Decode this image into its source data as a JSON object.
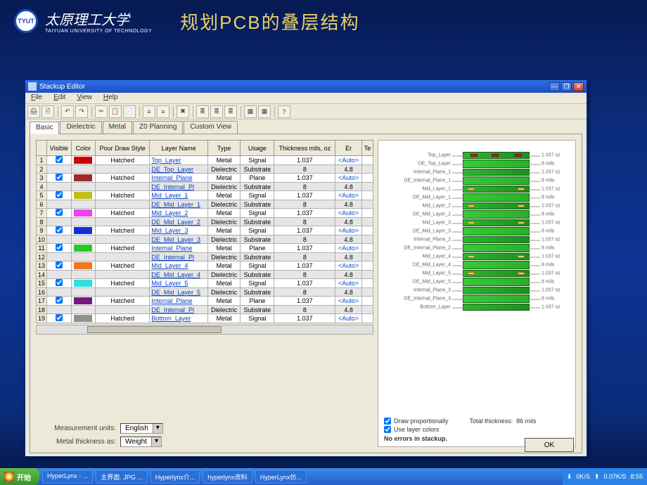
{
  "university": {
    "cn": "太原理工大学",
    "en": "TAIYUAN UNIVERSITY OF TECHNOLOGY"
  },
  "slide_title": "规划PCB的叠层结构",
  "app": {
    "title": "Stackup Editor",
    "menus": [
      "File",
      "Edit",
      "View",
      "Help"
    ],
    "tabs": [
      "Basic",
      "Dielectric",
      "Metal",
      "Z0 Planning",
      "Custom View"
    ],
    "active_tab": 0,
    "columns": [
      "",
      "Visible",
      "Color",
      "Pour Draw Style",
      "Layer Name",
      "Type",
      "Usage",
      "Thickness mils, oz",
      "Er",
      "Te"
    ],
    "rows": [
      {
        "n": "1",
        "vis": true,
        "color": "#d00000",
        "pds": "Hatched",
        "name": "Top_Layer",
        "type": "Metal",
        "usage": "Signal",
        "thk": "1.037",
        "er": "<Auto>"
      },
      {
        "n": "2",
        "vis": false,
        "color": "",
        "pds": "",
        "name": "DE_Top_Layer",
        "type": "Dielectric",
        "usage": "Substrate",
        "thk": "8",
        "er": "4.8",
        "sub": true
      },
      {
        "n": "3",
        "vis": true,
        "color": "#a02a2a",
        "pds": "Hatched",
        "name": "Internal_Plane",
        "type": "Metal",
        "usage": "Plane",
        "thk": "1.037",
        "er": "<Auto>"
      },
      {
        "n": "4",
        "vis": false,
        "color": "",
        "pds": "",
        "name": "DE_Internal_Pl",
        "type": "Dielectric",
        "usage": "Substrate",
        "thk": "8",
        "er": "4.8",
        "sub": true
      },
      {
        "n": "5",
        "vis": true,
        "color": "#c0c018",
        "pds": "Hatched",
        "name": "Mid_Layer_1",
        "type": "Metal",
        "usage": "Signal",
        "thk": "1.037",
        "er": "<Auto>"
      },
      {
        "n": "6",
        "vis": false,
        "color": "",
        "pds": "",
        "name": "DE_Mid_Layer_1",
        "type": "Dielectric",
        "usage": "Substrate",
        "thk": "8",
        "er": "4.8",
        "sub": true
      },
      {
        "n": "7",
        "vis": true,
        "color": "#ee44ee",
        "pds": "Hatched",
        "name": "Mid_Layer_2",
        "type": "Metal",
        "usage": "Signal",
        "thk": "1.037",
        "er": "<Auto>"
      },
      {
        "n": "8",
        "vis": false,
        "color": "",
        "pds": "",
        "name": "DE_Mid_Layer_2",
        "type": "Dielectric",
        "usage": "Substrate",
        "thk": "8",
        "er": "4.8",
        "sub": true
      },
      {
        "n": "9",
        "vis": true,
        "color": "#1030d8",
        "pds": "Hatched",
        "name": "Mid_Layer_3",
        "type": "Metal",
        "usage": "Signal",
        "thk": "1.037",
        "er": "<Auto>"
      },
      {
        "n": "10",
        "vis": false,
        "color": "",
        "pds": "",
        "name": "DE_Mid_Layer_3",
        "type": "Dielectric",
        "usage": "Substrate",
        "thk": "8",
        "er": "4.8",
        "sub": true
      },
      {
        "n": "11",
        "vis": true,
        "color": "#28c828",
        "pds": "Hatched",
        "name": "Internal_Plane",
        "type": "Metal",
        "usage": "Plane",
        "thk": "1.037",
        "er": "<Auto>"
      },
      {
        "n": "12",
        "vis": false,
        "color": "",
        "pds": "",
        "name": "DE_Internal_Pl",
        "type": "Dielectric",
        "usage": "Substrate",
        "thk": "8",
        "er": "4.8",
        "sub": true
      },
      {
        "n": "13",
        "vis": true,
        "color": "#f07820",
        "pds": "Hatched",
        "name": "Mid_Layer_4",
        "type": "Metal",
        "usage": "Signal",
        "thk": "1.037",
        "er": "<Auto>"
      },
      {
        "n": "14",
        "vis": false,
        "color": "",
        "pds": "",
        "name": "DE_Mid_Layer_4",
        "type": "Dielectric",
        "usage": "Substrate",
        "thk": "8",
        "er": "4.8",
        "sub": true
      },
      {
        "n": "15",
        "vis": true,
        "color": "#30e0e0",
        "pds": "Hatched",
        "name": "Mid_Layer_5",
        "type": "Metal",
        "usage": "Signal",
        "thk": "1.037",
        "er": "<Auto>"
      },
      {
        "n": "16",
        "vis": false,
        "color": "",
        "pds": "",
        "name": "DE_Mid_Layer_5",
        "type": "Dielectric",
        "usage": "Substrate",
        "thk": "8",
        "er": "4.8",
        "sub": true
      },
      {
        "n": "17",
        "vis": true,
        "color": "#781878",
        "pds": "Hatched",
        "name": "Internal_Plane",
        "type": "Metal",
        "usage": "Plane",
        "thk": "1.037",
        "er": "<Auto>"
      },
      {
        "n": "18",
        "vis": false,
        "color": "",
        "pds": "",
        "name": "DE_Internal_Pl",
        "type": "Dielectric",
        "usage": "Substrate",
        "thk": "8",
        "er": "4.8",
        "sub": true
      },
      {
        "n": "19",
        "vis": true,
        "color": "#909090",
        "pds": "Hatched",
        "name": "Bottom_Layer",
        "type": "Metal",
        "usage": "Signal",
        "thk": "1.037",
        "er": "<Auto>"
      }
    ],
    "measure_units_label": "Measurement units:",
    "measure_units_value": "English",
    "metal_thickness_label": "Metal thickness as:",
    "metal_thickness_value": "Weight",
    "vis": {
      "left_labels": [
        "Top_Layer",
        "DE_Top_Layer",
        "Internal_Plane_1",
        "DE_Internal_Plane_1",
        "Mid_Layer_1",
        "DE_Mid_Layer_1",
        "Mid_Layer_2",
        "DE_Mid_Layer_2",
        "Mid_Layer_3",
        "DE_Mid_Layer_3",
        "Internal_Plane_2",
        "DE_Internal_Plane_2",
        "Mid_Layer_4",
        "DE_Mid_Layer_4",
        "Mid_Layer_5",
        "DE_Mid_Layer_5",
        "Internal_Plane_3",
        "DE_Internal_Plane_3",
        "Bottom_Layer"
      ],
      "right_labels": [
        "1.037 oz",
        "8 mils",
        "1.037 oz",
        "8 mils",
        "1.037 oz",
        "8 mils",
        "1.037 oz",
        "8 mils",
        "1.037 oz",
        "8 mils",
        "1.037 oz",
        "8 mils",
        "1.037 oz",
        "8 mils",
        "1.037 oz",
        "8 mils",
        "1.037 oz",
        "8 mils",
        "1.037 oz"
      ],
      "draw_prop_label": "Draw proportionally",
      "draw_prop": true,
      "use_colors_label": "Use layer colors",
      "use_colors": true,
      "total_thickness_label": "Total thickness:",
      "total_thickness_value": "86 mils",
      "status": "No errors in stackup."
    },
    "ok": "OK"
  },
  "taskbar": {
    "start": "开始",
    "items": [
      "HyperLynx - ...",
      "主界面. JPG ...",
      "Hyperlynx介...",
      "hyperlynx资料",
      "HyperLynx仿..."
    ],
    "tray_speed_down": "0K/S",
    "tray_speed_up": "0.07K/S",
    "clock": "8:55"
  }
}
